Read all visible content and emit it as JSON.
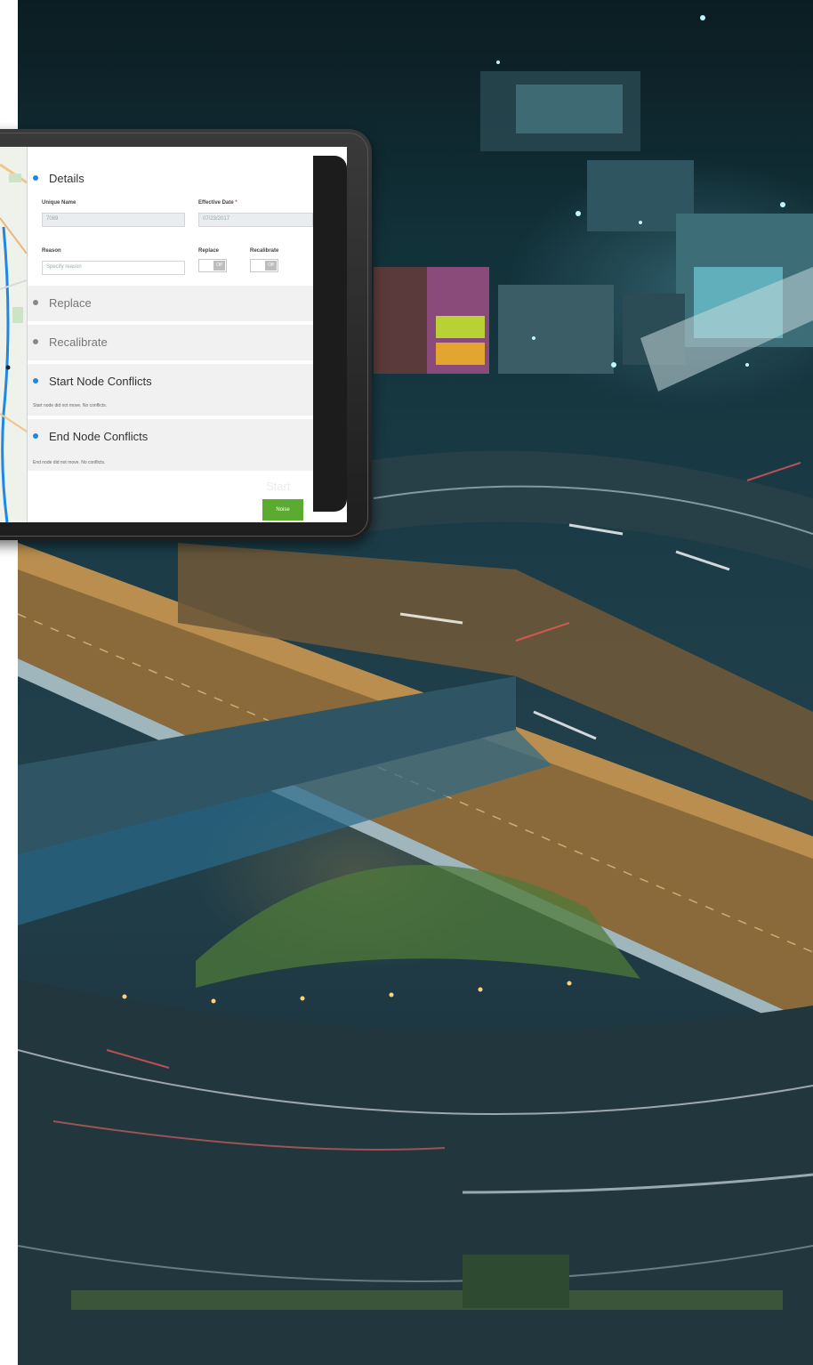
{
  "details": {
    "heading": "Details",
    "unique_name_label": "Unique Name",
    "unique_name_value": "7089",
    "effective_date_label": "Effective Date",
    "effective_date_required": "*",
    "effective_date_value": "07/23/2017",
    "reason_label": "Reason",
    "reason_placeholder": "Specify reason",
    "replace_label": "Replace",
    "recalibrate_label": "Recalibrate",
    "toggle_off_text": "Off"
  },
  "sections": {
    "replace": "Replace",
    "recalibrate": "Recalibrate",
    "start_node": "Start Node Conflicts",
    "start_node_note": "Start node did not move. No conflicts.",
    "end_node": "End Node Conflicts",
    "end_node_note": "End node did not move. No conflicts."
  },
  "footer": {
    "faded_text": "Start",
    "next_button": "Noise"
  },
  "colors": {
    "accent_blue": "#1e88e5",
    "button_green": "#5aab2f",
    "required_red": "#e53935"
  },
  "icons": [
    "section-dot-icon",
    "map-marker-icon"
  ]
}
